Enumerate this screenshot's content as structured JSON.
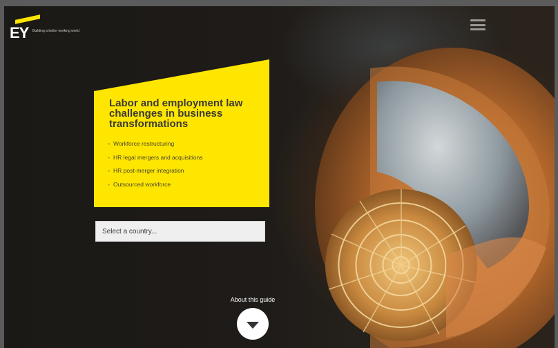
{
  "brand": {
    "logo_text": "EY",
    "tagline": "Building a better working world",
    "accent_color": "#ffe600"
  },
  "header": {
    "menu_icon": "hamburger-menu-icon"
  },
  "hero": {
    "title": "Labor and employment law challenges in business transformations",
    "items": [
      {
        "label": "Workforce restructuring"
      },
      {
        "label": "HR legal mergers and acquisitions"
      },
      {
        "label": "HR post-merger integration"
      },
      {
        "label": "Outsourced workforce"
      }
    ]
  },
  "country_select": {
    "placeholder": "Select a country..."
  },
  "about": {
    "label": "About this guide",
    "icon": "chevron-down-icon"
  },
  "background": {
    "image": "nautilus-shell"
  }
}
